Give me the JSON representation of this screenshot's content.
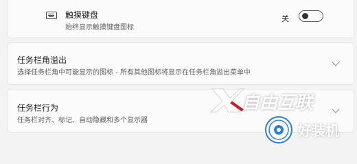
{
  "touch_keyboard": {
    "title": "触摸键盘",
    "subtitle": "始终显示触摸键盘图标",
    "toggle_state_label": "关",
    "toggle_on": false,
    "icon": "keyboard-icon"
  },
  "corner_overflow": {
    "title": "任务栏角溢出",
    "subtitle": "选择任务栏角中可能显示的图标 - 所有其他图标将显示在任务栏角溢出菜单中",
    "icon": "chevron-down-icon"
  },
  "taskbar_behaviors": {
    "title": "任务栏行为",
    "subtitle": "任务栏对齐、标记、自动隐藏和多个显示器",
    "icon": "chevron-down-icon"
  },
  "watermark": {
    "brand_text": "自由互联",
    "site_text": "好装机"
  }
}
